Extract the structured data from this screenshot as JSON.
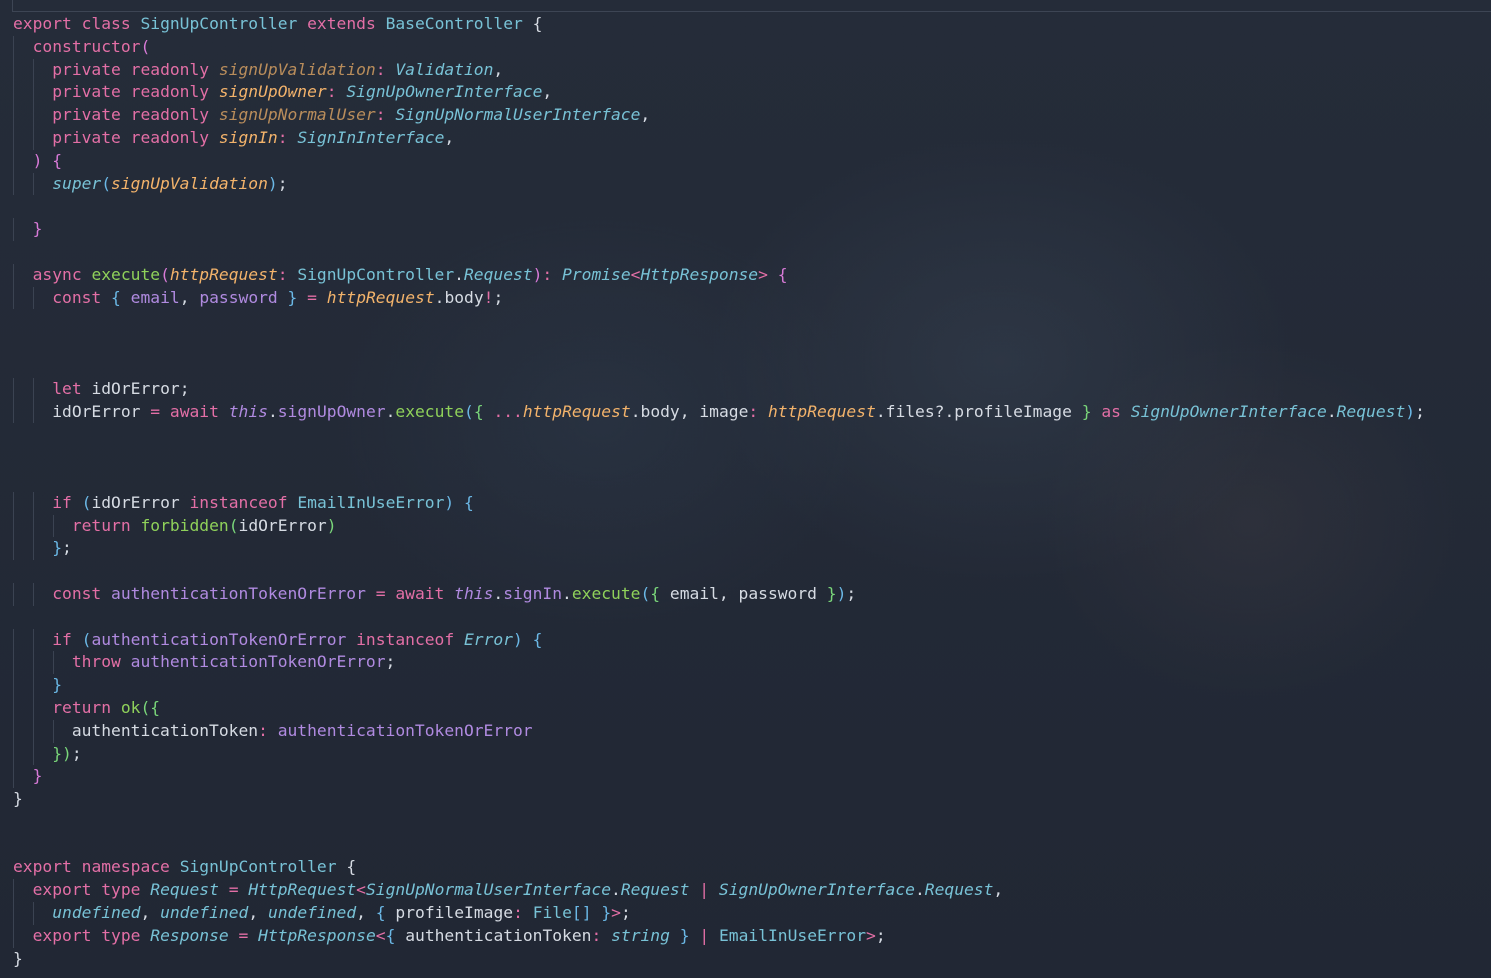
{
  "editor": {
    "language": "typescript",
    "lines": [
      [
        [
          "kw",
          "export"
        ],
        [
          "pl",
          " "
        ],
        [
          "kw",
          "class"
        ],
        [
          "pl",
          " "
        ],
        [
          "ty",
          "SignUpController"
        ],
        [
          "pl",
          " "
        ],
        [
          "kw",
          "extends"
        ],
        [
          "pl",
          " "
        ],
        [
          "ty",
          "BaseController"
        ],
        [
          "pl",
          " "
        ],
        [
          "pl",
          "{"
        ]
      ],
      [
        [
          "pl",
          "  "
        ],
        [
          "kw",
          "constructor"
        ],
        [
          "br2",
          "("
        ]
      ],
      [
        [
          "pl",
          "    "
        ],
        [
          "kw",
          "private"
        ],
        [
          "pl",
          " "
        ],
        [
          "kw",
          "readonly"
        ],
        [
          "pl",
          " "
        ],
        [
          "pard",
          "signUpValidation"
        ],
        [
          "op",
          ":"
        ],
        [
          "pl",
          " "
        ],
        [
          "tyi",
          "Validation"
        ],
        [
          "pl",
          ","
        ]
      ],
      [
        [
          "pl",
          "    "
        ],
        [
          "kw",
          "private"
        ],
        [
          "pl",
          " "
        ],
        [
          "kw",
          "readonly"
        ],
        [
          "pl",
          " "
        ],
        [
          "par",
          "signUpOwner"
        ],
        [
          "op",
          ":"
        ],
        [
          "pl",
          " "
        ],
        [
          "tyi",
          "SignUpOwnerInterface"
        ],
        [
          "pl",
          ","
        ]
      ],
      [
        [
          "pl",
          "    "
        ],
        [
          "kw",
          "private"
        ],
        [
          "pl",
          " "
        ],
        [
          "kw",
          "readonly"
        ],
        [
          "pl",
          " "
        ],
        [
          "pard",
          "signUpNormalUser"
        ],
        [
          "op",
          ":"
        ],
        [
          "pl",
          " "
        ],
        [
          "tyi",
          "SignUpNormalUserInterface"
        ],
        [
          "pl",
          ","
        ]
      ],
      [
        [
          "pl",
          "    "
        ],
        [
          "kw",
          "private"
        ],
        [
          "pl",
          " "
        ],
        [
          "kw",
          "readonly"
        ],
        [
          "pl",
          " "
        ],
        [
          "par",
          "signIn"
        ],
        [
          "op",
          ":"
        ],
        [
          "pl",
          " "
        ],
        [
          "tyi",
          "SignInInterface"
        ],
        [
          "pl",
          ","
        ]
      ],
      [
        [
          "pl",
          "  "
        ],
        [
          "br2",
          ")"
        ],
        [
          "pl",
          " "
        ],
        [
          "br2",
          "{"
        ]
      ],
      [
        [
          "pl",
          "    "
        ],
        [
          "tyi",
          "super"
        ],
        [
          "br3",
          "("
        ],
        [
          "par",
          "signUpValidation"
        ],
        [
          "br3",
          ")"
        ],
        [
          "pl",
          ";"
        ]
      ],
      [
        [
          "pl",
          ""
        ]
      ],
      [
        [
          "pl",
          "  "
        ],
        [
          "br2",
          "}"
        ]
      ],
      [
        [
          "pl",
          ""
        ]
      ],
      [
        [
          "pl",
          "  "
        ],
        [
          "kw",
          "async"
        ],
        [
          "pl",
          " "
        ],
        [
          "fn",
          "execute"
        ],
        [
          "br2",
          "("
        ],
        [
          "par",
          "httpRequest"
        ],
        [
          "op",
          ":"
        ],
        [
          "pl",
          " "
        ],
        [
          "ty",
          "SignUpController"
        ],
        [
          "pl",
          "."
        ],
        [
          "tyi",
          "Request"
        ],
        [
          "br2",
          ")"
        ],
        [
          "op",
          ":"
        ],
        [
          "pl",
          " "
        ],
        [
          "tyi",
          "Promise"
        ],
        [
          "op",
          "<"
        ],
        [
          "tyi",
          "HttpResponse"
        ],
        [
          "op",
          ">"
        ],
        [
          "pl",
          " "
        ],
        [
          "br2",
          "{"
        ]
      ],
      [
        [
          "pl",
          "    "
        ],
        [
          "kw",
          "const"
        ],
        [
          "pl",
          " "
        ],
        [
          "br3",
          "{"
        ],
        [
          "pl",
          " "
        ],
        [
          "prop",
          "email"
        ],
        [
          "pl",
          ","
        ],
        [
          "pl",
          " "
        ],
        [
          "prop",
          "password"
        ],
        [
          "pl",
          " "
        ],
        [
          "br3",
          "}"
        ],
        [
          "pl",
          " "
        ],
        [
          "op",
          "="
        ],
        [
          "pl",
          " "
        ],
        [
          "par",
          "httpRequest"
        ],
        [
          "pl",
          "."
        ],
        [
          "pl",
          "body"
        ],
        [
          "op",
          "!"
        ],
        [
          "pl",
          ";"
        ]
      ],
      [
        [
          "pl",
          ""
        ]
      ],
      [
        [
          "pl",
          ""
        ]
      ],
      [
        [
          "pl",
          ""
        ]
      ],
      [
        [
          "pl",
          "    "
        ],
        [
          "kw",
          "let"
        ],
        [
          "pl",
          " "
        ],
        [
          "pl",
          "idOrError"
        ],
        [
          "pl",
          ";"
        ]
      ],
      [
        [
          "pl",
          "    "
        ],
        [
          "pl",
          "idOrError"
        ],
        [
          "pl",
          " "
        ],
        [
          "op",
          "="
        ],
        [
          "pl",
          " "
        ],
        [
          "kw",
          "await"
        ],
        [
          "pl",
          " "
        ],
        [
          "thisk",
          "this"
        ],
        [
          "pl",
          "."
        ],
        [
          "prop",
          "signUpOwner"
        ],
        [
          "pl",
          "."
        ],
        [
          "fn",
          "execute"
        ],
        [
          "br3",
          "("
        ],
        [
          "brg",
          "{"
        ],
        [
          "pl",
          " "
        ],
        [
          "op",
          "..."
        ],
        [
          "par",
          "httpRequest"
        ],
        [
          "pl",
          "."
        ],
        [
          "pl",
          "body"
        ],
        [
          "pl",
          ","
        ],
        [
          "pl",
          " "
        ],
        [
          "pl",
          "image"
        ],
        [
          "op",
          ":"
        ],
        [
          "pl",
          " "
        ],
        [
          "par",
          "httpRequest"
        ],
        [
          "pl",
          "."
        ],
        [
          "pl",
          "files"
        ],
        [
          "pl",
          "?."
        ],
        [
          "pl",
          "profileImage"
        ],
        [
          "pl",
          " "
        ],
        [
          "brg",
          "}"
        ],
        [
          "pl",
          " "
        ],
        [
          "kw",
          "as"
        ],
        [
          "pl",
          " "
        ],
        [
          "tyi",
          "SignUpOwnerInterface"
        ],
        [
          "pl",
          "."
        ],
        [
          "tyi",
          "Request"
        ],
        [
          "br3",
          ")"
        ],
        [
          "pl",
          ";"
        ]
      ],
      [
        [
          "pl",
          ""
        ]
      ],
      [
        [
          "pl",
          ""
        ]
      ],
      [
        [
          "pl",
          ""
        ]
      ],
      [
        [
          "pl",
          "    "
        ],
        [
          "kw",
          "if"
        ],
        [
          "pl",
          " "
        ],
        [
          "br3",
          "("
        ],
        [
          "pl",
          "idOrError"
        ],
        [
          "pl",
          " "
        ],
        [
          "kw",
          "instanceof"
        ],
        [
          "pl",
          " "
        ],
        [
          "ty",
          "EmailInUseError"
        ],
        [
          "br3",
          ")"
        ],
        [
          "pl",
          " "
        ],
        [
          "br3",
          "{"
        ]
      ],
      [
        [
          "pl",
          "      "
        ],
        [
          "kw",
          "return"
        ],
        [
          "pl",
          " "
        ],
        [
          "fn",
          "forbidden"
        ],
        [
          "brg",
          "("
        ],
        [
          "pl",
          "idOrError"
        ],
        [
          "brg",
          ")"
        ]
      ],
      [
        [
          "pl",
          "    "
        ],
        [
          "br3",
          "}"
        ],
        [
          "pl",
          ";"
        ]
      ],
      [
        [
          "pl",
          ""
        ]
      ],
      [
        [
          "pl",
          "    "
        ],
        [
          "kw",
          "const"
        ],
        [
          "pl",
          " "
        ],
        [
          "prop",
          "authenticationTokenOrError"
        ],
        [
          "pl",
          " "
        ],
        [
          "op",
          "="
        ],
        [
          "pl",
          " "
        ],
        [
          "kw",
          "await"
        ],
        [
          "pl",
          " "
        ],
        [
          "thisk",
          "this"
        ],
        [
          "pl",
          "."
        ],
        [
          "prop",
          "signIn"
        ],
        [
          "pl",
          "."
        ],
        [
          "fn",
          "execute"
        ],
        [
          "br3",
          "("
        ],
        [
          "brg",
          "{"
        ],
        [
          "pl",
          " "
        ],
        [
          "pl",
          "email"
        ],
        [
          "pl",
          ","
        ],
        [
          "pl",
          " "
        ],
        [
          "pl",
          "password"
        ],
        [
          "pl",
          " "
        ],
        [
          "brg",
          "}"
        ],
        [
          "br3",
          ")"
        ],
        [
          "pl",
          ";"
        ]
      ],
      [
        [
          "pl",
          ""
        ]
      ],
      [
        [
          "pl",
          "    "
        ],
        [
          "kw",
          "if"
        ],
        [
          "pl",
          " "
        ],
        [
          "br3",
          "("
        ],
        [
          "prop",
          "authenticationTokenOrError"
        ],
        [
          "pl",
          " "
        ],
        [
          "kw",
          "instanceof"
        ],
        [
          "pl",
          " "
        ],
        [
          "tyi",
          "Error"
        ],
        [
          "br3",
          ")"
        ],
        [
          "pl",
          " "
        ],
        [
          "br3",
          "{"
        ]
      ],
      [
        [
          "pl",
          "      "
        ],
        [
          "kw",
          "throw"
        ],
        [
          "pl",
          " "
        ],
        [
          "prop",
          "authenticationTokenOrError"
        ],
        [
          "pl",
          ";"
        ]
      ],
      [
        [
          "pl",
          "    "
        ],
        [
          "br3",
          "}"
        ]
      ],
      [
        [
          "pl",
          "    "
        ],
        [
          "kw",
          "return"
        ],
        [
          "pl",
          " "
        ],
        [
          "fn",
          "ok"
        ],
        [
          "brg",
          "("
        ],
        [
          "brg",
          "{"
        ]
      ],
      [
        [
          "pl",
          "      "
        ],
        [
          "pl",
          "authenticationToken"
        ],
        [
          "op",
          ":"
        ],
        [
          "pl",
          " "
        ],
        [
          "prop",
          "authenticationTokenOrError"
        ]
      ],
      [
        [
          "pl",
          "    "
        ],
        [
          "brg",
          "}"
        ],
        [
          "brg",
          ")"
        ],
        [
          "pl",
          ";"
        ]
      ],
      [
        [
          "pl",
          "  "
        ],
        [
          "br2",
          "}"
        ]
      ],
      [
        [
          "pl",
          "}"
        ]
      ],
      [
        [
          "pl",
          ""
        ]
      ],
      [
        [
          "pl",
          ""
        ]
      ],
      [
        [
          "kw",
          "export"
        ],
        [
          "pl",
          " "
        ],
        [
          "kw",
          "namespace"
        ],
        [
          "pl",
          " "
        ],
        [
          "ty",
          "SignUpController"
        ],
        [
          "pl",
          " "
        ],
        [
          "pl",
          "{"
        ]
      ],
      [
        [
          "pl",
          "  "
        ],
        [
          "kw",
          "export"
        ],
        [
          "pl",
          " "
        ],
        [
          "kw",
          "type"
        ],
        [
          "pl",
          " "
        ],
        [
          "tyi",
          "Request"
        ],
        [
          "pl",
          " "
        ],
        [
          "op",
          "="
        ],
        [
          "pl",
          " "
        ],
        [
          "tyi",
          "HttpRequest"
        ],
        [
          "op",
          "<"
        ],
        [
          "tyi",
          "SignUpNormalUserInterface"
        ],
        [
          "pl",
          "."
        ],
        [
          "tyi",
          "Request"
        ],
        [
          "pl",
          " "
        ],
        [
          "op",
          "|"
        ],
        [
          "pl",
          " "
        ],
        [
          "tyi",
          "SignUpOwnerInterface"
        ],
        [
          "pl",
          "."
        ],
        [
          "tyi",
          "Request"
        ],
        [
          "pl",
          ","
        ]
      ],
      [
        [
          "pl",
          "    "
        ],
        [
          "tyi",
          "undefined"
        ],
        [
          "pl",
          ","
        ],
        [
          "pl",
          " "
        ],
        [
          "tyi",
          "undefined"
        ],
        [
          "pl",
          ","
        ],
        [
          "pl",
          " "
        ],
        [
          "tyi",
          "undefined"
        ],
        [
          "pl",
          ","
        ],
        [
          "pl",
          " "
        ],
        [
          "br3",
          "{"
        ],
        [
          "pl",
          " "
        ],
        [
          "pl",
          "profileImage"
        ],
        [
          "op",
          ":"
        ],
        [
          "pl",
          " "
        ],
        [
          "ty",
          "File"
        ],
        [
          "br3",
          "[]"
        ],
        [
          "pl",
          " "
        ],
        [
          "br3",
          "}"
        ],
        [
          "op",
          ">"
        ],
        [
          "pl",
          ";"
        ]
      ],
      [
        [
          "pl",
          "  "
        ],
        [
          "kw",
          "export"
        ],
        [
          "pl",
          " "
        ],
        [
          "kw",
          "type"
        ],
        [
          "pl",
          " "
        ],
        [
          "tyi",
          "Response"
        ],
        [
          "pl",
          " "
        ],
        [
          "op",
          "="
        ],
        [
          "pl",
          " "
        ],
        [
          "tyi",
          "HttpResponse"
        ],
        [
          "op",
          "<"
        ],
        [
          "br3",
          "{"
        ],
        [
          "pl",
          " "
        ],
        [
          "pl",
          "authenticationToken"
        ],
        [
          "op",
          ":"
        ],
        [
          "pl",
          " "
        ],
        [
          "tyi",
          "string"
        ],
        [
          "pl",
          " "
        ],
        [
          "br3",
          "}"
        ],
        [
          "pl",
          " "
        ],
        [
          "op",
          "|"
        ],
        [
          "pl",
          " "
        ],
        [
          "ty",
          "EmailInUseError"
        ],
        [
          "op",
          ">"
        ],
        [
          "pl",
          ";"
        ]
      ],
      [
        [
          "pl",
          "}"
        ]
      ]
    ]
  }
}
